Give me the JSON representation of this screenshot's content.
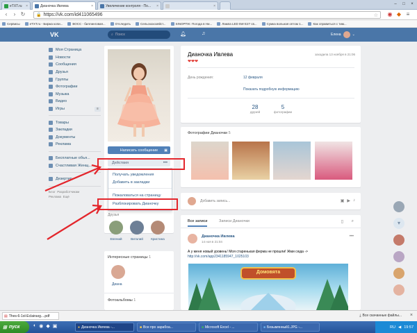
{
  "browser": {
    "tabs": [
      {
        "title": "eTXT.ru",
        "active": false
      },
      {
        "title": "Дианочка Ивлева",
        "active": true
      },
      {
        "title": "Увеличение контроля - По...",
        "active": false
      },
      {
        "title": "",
        "active": false
      },
      {
        "title": "",
        "active": false
      }
    ],
    "url": "https://vk.com/id411065496",
    "bookmarks": [
      "Сервисы",
      "eTXT.ru - Биржа копи...",
      "ВОСС - биллинговая...",
      "Отследить",
      "Сельскохозяйст...",
      "SINOPTIK: Погода в Ни...",
      "Лампа LED 5W E27 св...",
      "Сумка вольная оптом 1...",
      "Как справиться с тим..."
    ]
  },
  "vk_header": {
    "logo": "VK",
    "search_placeholder": "Поиск",
    "user_name": "Елена"
  },
  "left_menu": {
    "items": [
      "Моя Страница",
      "Новости",
      "Сообщения",
      "Друзья",
      "Группы",
      "Фотографии",
      "Музыка",
      "Видео",
      "Игры"
    ],
    "items2": [
      "Товары",
      "Закладки",
      "Документы",
      "Реклама"
    ],
    "items3": [
      "Бесплатные объя...",
      "Счастливая Женщ..."
    ],
    "items4": [
      "Дезертир"
    ],
    "footer": [
      "Блог",
      "Разработчикам",
      "Реклама",
      "Ещё"
    ]
  },
  "profile": {
    "write_message": "Написать сообщение",
    "actions_button": "Действия",
    "dropdown": [
      "Получать уведомления",
      "Добавить в закладки",
      "Пожаловаться на страницу",
      "Разблокировать Дианочку"
    ],
    "friends_header": "Друзья",
    "friends": [
      "Евгений",
      "Виталий",
      "Кристина"
    ],
    "interesting_header": "Интересные страницы",
    "interesting_count": "1",
    "interesting_name": "Диана",
    "albums_header": "Фотоальбомы",
    "albums_count": "1"
  },
  "info": {
    "name": "Дианочка Ивлева",
    "status": "❤❤❤",
    "last_seen": "заходила 13 ноября в 21:06",
    "birthday_label": "День рождения:",
    "birthday_value": "12 февраля",
    "show_more": "Показать подробную информацию",
    "friends_count": "28",
    "friends_label": "друзей",
    "photos_count": "5",
    "photos_label": "фотографии"
  },
  "photos_section": {
    "title": "Фотографии Дианочки",
    "count": "5"
  },
  "compose": {
    "placeholder": "Добавить запись..."
  },
  "wall": {
    "tab_all": "Все записи",
    "tab_own": "Записи Дианочки",
    "post_author": "Дианочка Ивлева",
    "post_date": "14 ноя в 21:04",
    "post_text": "А у меня новый уровень! Моя старенькая ферма не прошли! Жми сюда ->",
    "post_link": "http://vk.com/app2341185947_1025103",
    "game_title": "Домовята"
  },
  "downloads": {
    "file": "Thes-6-1ol-Eclairaxg....pdf",
    "show_all": "Все скачанные файлы..."
  },
  "taskbar": {
    "start": "пуск",
    "buttons": [
      "Дианочка Ивлева -...",
      "Все про зарабоа...",
      "Microsoft Excel - ...",
      "Безымянный1.JPG -..."
    ],
    "lang": "RU",
    "time": "19:57"
  },
  "colors": {
    "accent": "#4a76a8",
    "annotation": "#e3262c",
    "link": "#2a5885"
  }
}
